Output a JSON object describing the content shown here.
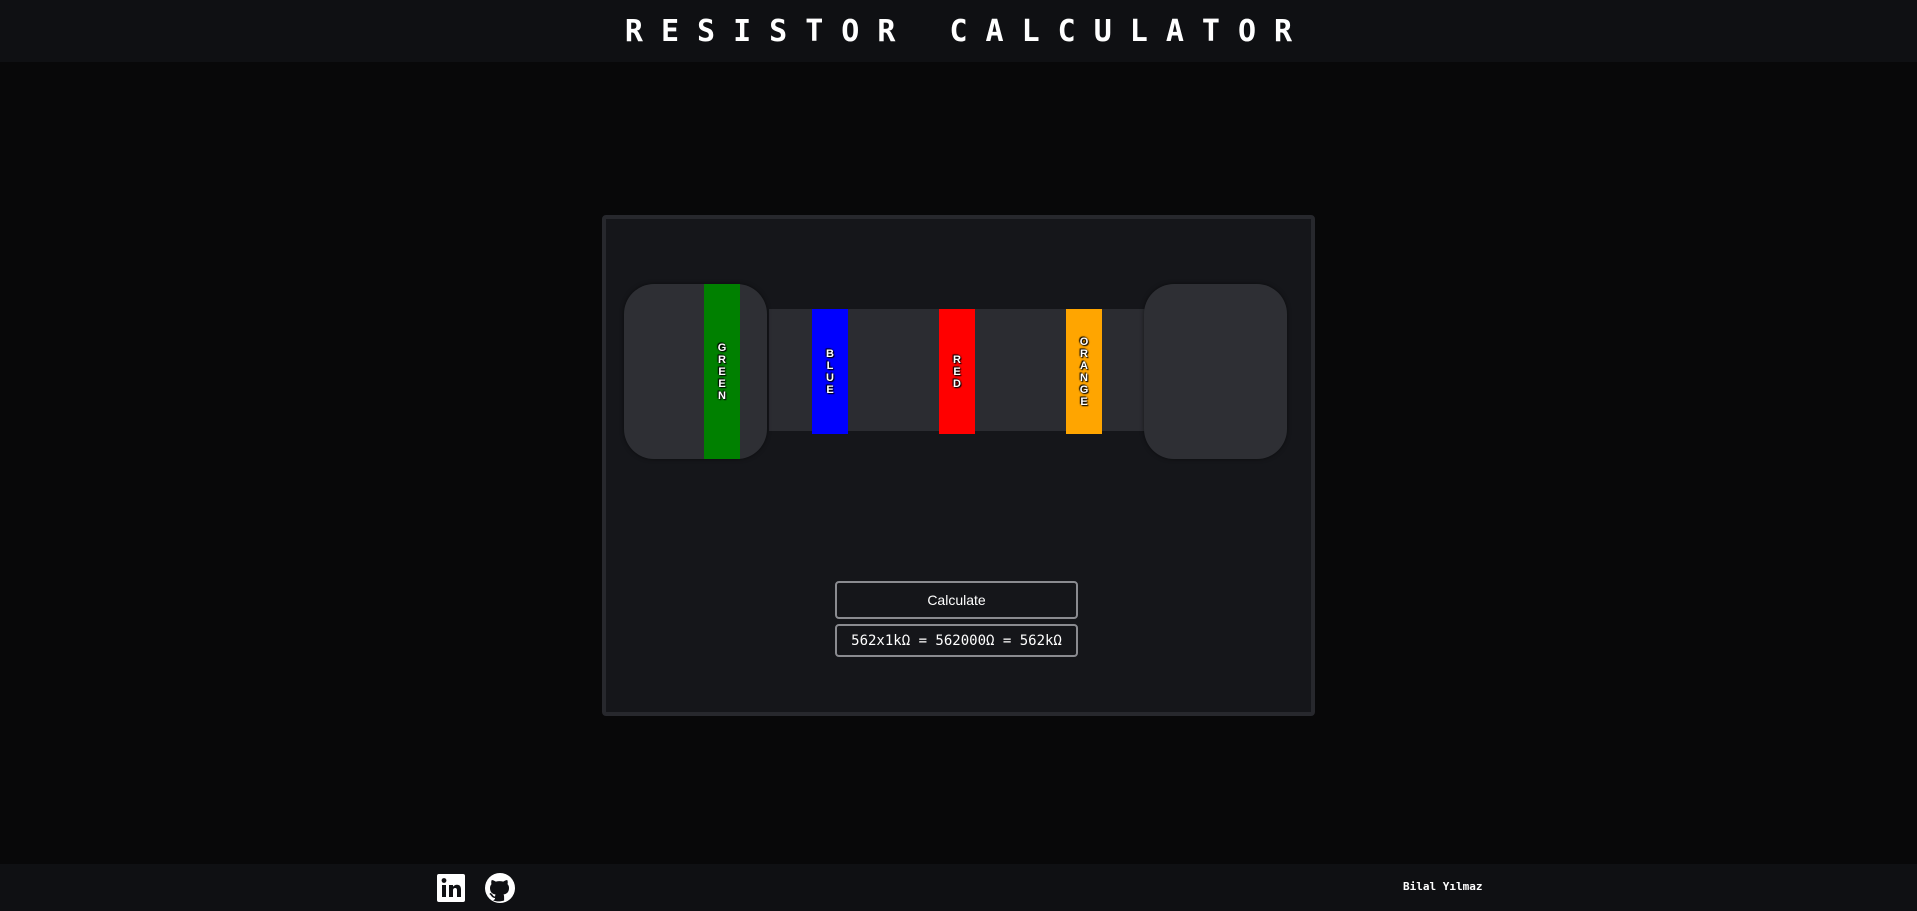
{
  "header": {
    "title": "RESISTOR CALCULATOR"
  },
  "resistor": {
    "bands": [
      {
        "label": "GREEN",
        "color": "#008000"
      },
      {
        "label": "BLUE",
        "color": "#0000ff"
      },
      {
        "label": "RED",
        "color": "#ff0000"
      },
      {
        "label": "ORANGE",
        "color": "#ffa500"
      }
    ]
  },
  "calculator": {
    "button_label": "Calculate",
    "result": "562x1kΩ = 562000Ω = 562kΩ"
  },
  "footer": {
    "icons": [
      "linkedin-icon",
      "github-icon"
    ],
    "author": "Bilal Yılmaz"
  }
}
